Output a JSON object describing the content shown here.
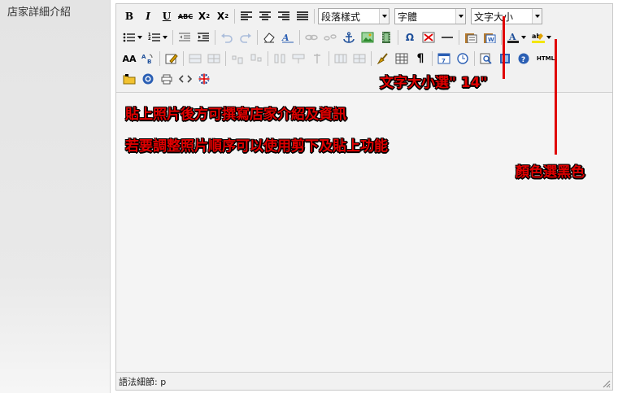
{
  "form": {
    "field_label": "店家詳細介紹"
  },
  "toolbar": {
    "bold": "B",
    "italic": "I",
    "underline": "U",
    "strike": "ABC",
    "subscript": "X",
    "superscript": "X",
    "format_combo": "段落樣式",
    "font_combo": "字體",
    "size_combo": "文字大小",
    "find": "AA",
    "pilcrow": "¶",
    "omega": "Ω",
    "html_label": "HTML"
  },
  "status_bar": {
    "path_text": "語法細節: p"
  },
  "annotations": {
    "size_hint": "文字大小選\" 14\"",
    "paste_hint": "貼上照片後方可撰寫店家介紹及資訊",
    "reorder_hint": "若要調整照片順序可以使用剪下及貼上功能",
    "color_hint": "顏色選黑色"
  },
  "colors": {
    "annotation": "#e00000",
    "icon_blue": "#2b5fb4",
    "icon_green": "#2e8b2e",
    "icon_gold": "#e0a200"
  }
}
